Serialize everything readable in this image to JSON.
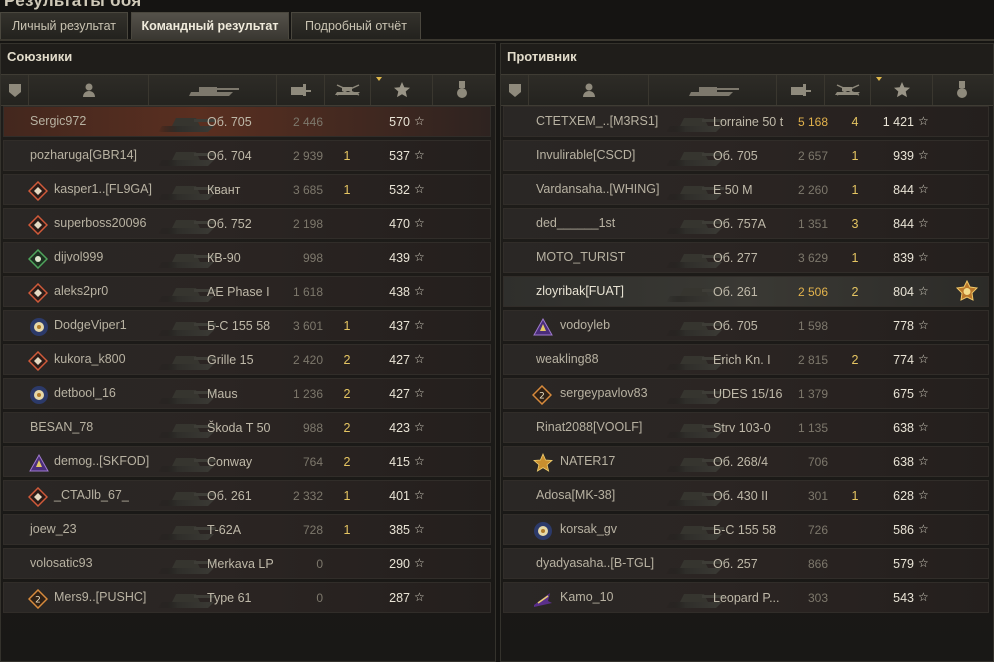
{
  "window_title": "Результаты боя",
  "tabs": [
    {
      "label": "Личный результат",
      "active": false
    },
    {
      "label": "Командный результат",
      "active": true
    },
    {
      "label": "Подробный отчёт",
      "active": false
    }
  ],
  "columns": {
    "icons": [
      "platoon-icon",
      "player-icon",
      "tank-icon",
      "damage-icon",
      "kills-icon",
      "xp-star-icon",
      "medal-icon"
    ],
    "sorted_by": "xp"
  },
  "teams": [
    {
      "title": "Союзники",
      "rows": [
        {
          "player": "Sergic972",
          "badge": "",
          "vehicle": "Об. 705",
          "damage": "2 446",
          "kills": "",
          "xp": "570",
          "mine": true
        },
        {
          "player": "pozharuga[GBR14]",
          "badge": "",
          "vehicle": "Об. 704",
          "damage": "2 939",
          "kills": "1",
          "xp": "537"
        },
        {
          "player": "kasper1..[FL9GA]",
          "badge": "red-diamond",
          "vehicle": "Квант",
          "damage": "3 685",
          "kills": "1",
          "xp": "532"
        },
        {
          "player": "superboss20096",
          "badge": "red-diamond",
          "vehicle": "Об. 752",
          "damage": "2 198",
          "kills": "",
          "xp": "470"
        },
        {
          "player": "dijvol999",
          "badge": "green-diamond",
          "vehicle": "КВ-90",
          "damage": "998",
          "kills": "",
          "xp": "439"
        },
        {
          "player": "aleks2pr0",
          "badge": "red-diamond",
          "vehicle": "AE Phase I",
          "damage": "1 618",
          "kills": "",
          "xp": "438"
        },
        {
          "player": "DodgeViper1",
          "badge": "blue-flower",
          "vehicle": "Б-С 155 58",
          "damage": "3 601",
          "kills": "1",
          "xp": "437"
        },
        {
          "player": "kukora_k800",
          "badge": "red-diamond",
          "vehicle": "Grille 15",
          "damage": "2 420",
          "kills": "2",
          "xp": "427"
        },
        {
          "player": "detbool_16",
          "badge": "blue-flower",
          "vehicle": "Maus",
          "damage": "1 236",
          "kills": "2",
          "xp": "427"
        },
        {
          "player": "BESAN_78",
          "badge": "",
          "vehicle": "Škoda T 50",
          "damage": "988",
          "kills": "2",
          "xp": "423"
        },
        {
          "player": "demog..[SKFOD]",
          "badge": "purple-wing",
          "vehicle": "Conway",
          "damage": "764",
          "kills": "2",
          "xp": "415"
        },
        {
          "player": "_CTAJlb_67_",
          "badge": "red-diamond",
          "vehicle": "Об. 261",
          "damage": "2 332",
          "kills": "1",
          "xp": "401"
        },
        {
          "player": "joew_23",
          "badge": "",
          "vehicle": "Т-62А",
          "damage": "728",
          "kills": "1",
          "xp": "385"
        },
        {
          "player": "volosatic93",
          "badge": "",
          "vehicle": "Merkava LP",
          "damage": "0",
          "kills": "",
          "xp": "290"
        },
        {
          "player": "Mers9..[PUSHC]",
          "badge": "orange-diamond",
          "vehicle": "Type 61",
          "damage": "0",
          "kills": "",
          "xp": "287"
        }
      ]
    },
    {
      "title": "Противник",
      "rows": [
        {
          "player": "CTETXEM_..[M3RS1]",
          "badge": "",
          "vehicle": "Lorraine 50 t",
          "damage": "5 168",
          "kills": "4",
          "xp": "1 421",
          "gold_damage": true
        },
        {
          "player": "Invulirable[CSCD]",
          "badge": "",
          "vehicle": "Об. 705",
          "damage": "2 657",
          "kills": "1",
          "xp": "939"
        },
        {
          "player": "Vardansaha..[WHING]",
          "badge": "",
          "vehicle": "E 50 M",
          "damage": "2 260",
          "kills": "1",
          "xp": "844"
        },
        {
          "player": "ded______1st",
          "badge": "",
          "vehicle": "Об. 757А",
          "damage": "1 351",
          "kills": "3",
          "xp": "844"
        },
        {
          "player": "MOTO_TURIST",
          "badge": "",
          "vehicle": "Об. 277",
          "damage": "3 629",
          "kills": "1",
          "xp": "839"
        },
        {
          "player": "zloyribak[FUAT]",
          "badge": "",
          "vehicle": "Об. 261",
          "damage": "2 506",
          "kills": "2",
          "xp": "804",
          "gold_damage": true,
          "highlight": true,
          "medal": "battle-hero-medal-icon"
        },
        {
          "player": "vodoyleb",
          "badge": "purple-wing",
          "vehicle": "Об. 705",
          "damage": "1 598",
          "kills": "",
          "xp": "778"
        },
        {
          "player": "weakling88",
          "badge": "",
          "vehicle": "Erich Kn. I",
          "damage": "2 815",
          "kills": "2",
          "xp": "774"
        },
        {
          "player": "sergeypavlov83",
          "badge": "orange-diamond",
          "vehicle": "UDES 15/16",
          "damage": "1 379",
          "kills": "",
          "xp": "675"
        },
        {
          "player": "Rinat2088[VOOLF]",
          "badge": "",
          "vehicle": "Strv 103-0",
          "damage": "1 135",
          "kills": "",
          "xp": "638"
        },
        {
          "player": "NATER17",
          "badge": "gold-star",
          "vehicle": "Об. 268/4",
          "damage": "706",
          "kills": "",
          "xp": "638"
        },
        {
          "player": "Adosa[MK-38]",
          "badge": "",
          "vehicle": "Об. 430 II",
          "damage": "301",
          "kills": "1",
          "xp": "628"
        },
        {
          "player": "korsak_gv",
          "badge": "blue-flower",
          "vehicle": "Б-С 155 58",
          "damage": "726",
          "kills": "",
          "xp": "586"
        },
        {
          "player": "dyadyasaha..[B-TGL]",
          "badge": "",
          "vehicle": "Об. 257",
          "damage": "866",
          "kills": "",
          "xp": "579"
        },
        {
          "player": "Kamo_10",
          "badge": "purple-arrow",
          "vehicle": "Leopard P...",
          "damage": "303",
          "kills": "",
          "xp": "543"
        }
      ]
    }
  ],
  "colors": {
    "gold": "#e3b34c",
    "mine_row": "#5a2f20",
    "highlight_row": "#3a3934"
  }
}
